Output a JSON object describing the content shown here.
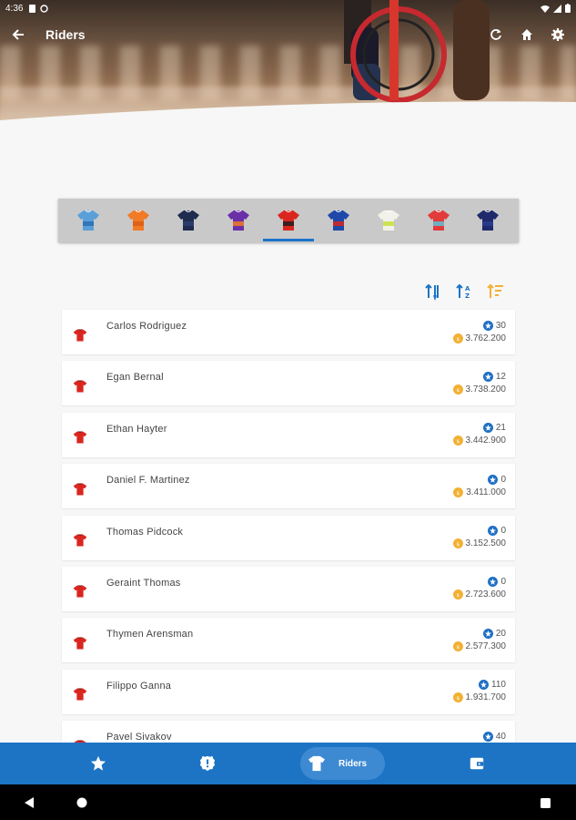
{
  "status_bar": {
    "time": "4:36"
  },
  "app_bar": {
    "title": "Riders"
  },
  "teams": [
    {
      "name": "team-1",
      "colors": [
        "#5b9fd8",
        "#2a6fb0"
      ]
    },
    {
      "name": "team-2",
      "colors": [
        "#f07a26",
        "#d95d14"
      ]
    },
    {
      "name": "team-3",
      "colors": [
        "#1f2c4f",
        "#2c4170"
      ]
    },
    {
      "name": "team-4",
      "colors": [
        "#6b2fa8",
        "#f07a26"
      ]
    },
    {
      "name": "team-5",
      "colors": [
        "#d9261f",
        "#1e1e1e"
      ],
      "selected": true
    },
    {
      "name": "team-6",
      "colors": [
        "#1f48a8",
        "#d9261f"
      ]
    },
    {
      "name": "team-7",
      "colors": [
        "#f2f2ea",
        "#c8e03a"
      ]
    },
    {
      "name": "team-8",
      "colors": [
        "#e23b3b",
        "#5ec3d6"
      ]
    },
    {
      "name": "team-9",
      "colors": [
        "#1e2a6b",
        "#2c3d8f"
      ]
    }
  ],
  "riders": [
    {
      "name": "Carlos Rodriguez",
      "points": "30",
      "price": "3.762.200"
    },
    {
      "name": "Egan Bernal",
      "points": "12",
      "price": "3.738.200"
    },
    {
      "name": "Ethan Hayter",
      "points": "21",
      "price": "3.442.900"
    },
    {
      "name": "Daniel F. Martinez",
      "points": "0",
      "price": "3.411.000"
    },
    {
      "name": "Thomas Pidcock",
      "points": "0",
      "price": "3.152.500"
    },
    {
      "name": "Geraint Thomas",
      "points": "0",
      "price": "2.723.600"
    },
    {
      "name": "Thymen Arensman",
      "points": "20",
      "price": "2.577.300"
    },
    {
      "name": "Filippo Ganna",
      "points": "110",
      "price": "1.931.700"
    },
    {
      "name": "Pavel Sivakov",
      "points": "40",
      "price": ""
    }
  ],
  "bottom_nav": {
    "active_label": "Riders"
  },
  "colors": {
    "primary": "#1d74c4",
    "coin": "#f2b134",
    "jersey": "#d9261f",
    "sort_active": "#f2b134"
  }
}
